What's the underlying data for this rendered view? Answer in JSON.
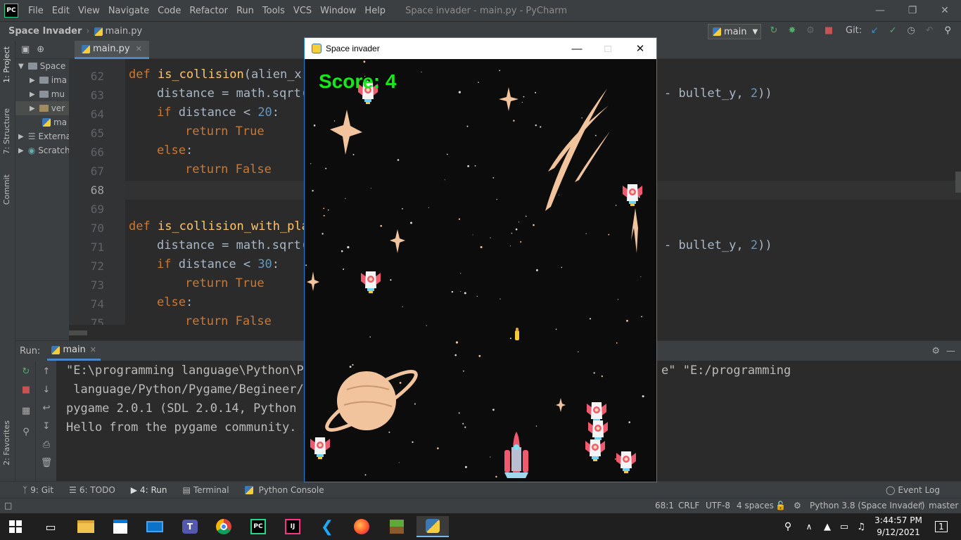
{
  "menubar": {
    "logo": "PC",
    "items": [
      "File",
      "Edit",
      "View",
      "Navigate",
      "Code",
      "Refactor",
      "Run",
      "Tools",
      "VCS",
      "Window",
      "Help"
    ],
    "title": "Space invader - main.py - PyCharm"
  },
  "navbar": {
    "project": "Space Invader",
    "file": "main.py",
    "branch": "main",
    "git_label": "Git:"
  },
  "sidebar": {
    "project_label": "1: Project",
    "structure_label": "7: Structure",
    "commit_label": "Commit",
    "favorites_label": "2: Favorites"
  },
  "project_tree": {
    "items": [
      "Space",
      "ima",
      "mu",
      "ver",
      "ma",
      "Externa",
      "Scratch"
    ]
  },
  "editor": {
    "tab": "main.py",
    "lines": [
      {
        "n": "62",
        "indent": 0,
        "parts": [
          {
            "t": "def ",
            "c": "kw"
          },
          {
            "t": "is_collision",
            "c": "fn"
          },
          {
            "t": "(alien_x,",
            "c": ""
          }
        ]
      },
      {
        "n": "63",
        "indent": 1,
        "parts": [
          {
            "t": "distance = math.sqrt(",
            "c": ""
          }
        ],
        "tail": [
          {
            "t": "- bullet_y, ",
            "c": ""
          },
          {
            "t": "2",
            "c": "num"
          },
          {
            "t": "))",
            "c": ""
          }
        ]
      },
      {
        "n": "64",
        "indent": 1,
        "parts": [
          {
            "t": "if ",
            "c": "kw"
          },
          {
            "t": "distance < ",
            "c": ""
          },
          {
            "t": "20",
            "c": "num"
          },
          {
            "t": ":",
            "c": ""
          }
        ]
      },
      {
        "n": "65",
        "indent": 2,
        "parts": [
          {
            "t": "return True",
            "c": "kw"
          }
        ]
      },
      {
        "n": "66",
        "indent": 1,
        "parts": [
          {
            "t": "else",
            "c": "kw"
          },
          {
            "t": ":",
            "c": ""
          }
        ]
      },
      {
        "n": "67",
        "indent": 2,
        "parts": [
          {
            "t": "return False",
            "c": "kw"
          }
        ]
      },
      {
        "n": "68",
        "indent": 0,
        "parts": []
      },
      {
        "n": "69",
        "indent": 0,
        "parts": []
      },
      {
        "n": "70",
        "indent": 0,
        "parts": [
          {
            "t": "def ",
            "c": "kw"
          },
          {
            "t": "is_collision_with_pla",
            "c": "fn"
          }
        ]
      },
      {
        "n": "71",
        "indent": 1,
        "parts": [
          {
            "t": "distance = math.sqrt(",
            "c": ""
          }
        ],
        "tail": [
          {
            "t": "- bullet_y, ",
            "c": ""
          },
          {
            "t": "2",
            "c": "num"
          },
          {
            "t": "))",
            "c": ""
          }
        ]
      },
      {
        "n": "72",
        "indent": 1,
        "parts": [
          {
            "t": "if ",
            "c": "kw"
          },
          {
            "t": "distance < ",
            "c": ""
          },
          {
            "t": "30",
            "c": "num"
          },
          {
            "t": ":",
            "c": ""
          }
        ]
      },
      {
        "n": "73",
        "indent": 2,
        "parts": [
          {
            "t": "return True",
            "c": "kw"
          }
        ]
      },
      {
        "n": "74",
        "indent": 1,
        "parts": [
          {
            "t": "else",
            "c": "kw"
          },
          {
            "t": ":",
            "c": ""
          }
        ]
      },
      {
        "n": "75",
        "indent": 2,
        "parts": [
          {
            "t": "return False",
            "c": "kw"
          }
        ]
      }
    ]
  },
  "run": {
    "label": "Run:",
    "tab": "main",
    "output": [
      {
        "a": "\"E:\\programming language\\Python\\Py",
        "b": "e\" \"E:/programming"
      },
      {
        "a": " language/Python/Pygame/Begineer/S",
        "b": ""
      },
      {
        "a": "pygame 2.0.1 (SDL 2.0.14, Python 3",
        "b": ""
      },
      {
        "a": "Hello from the pygame community. ",
        "link": "h",
        "b": ""
      }
    ]
  },
  "bottom_tools": {
    "git": "9: Git",
    "todo": "6: TODO",
    "run": "4: Run",
    "terminal": "Terminal",
    "console": "Python Console",
    "event_log": "Event Log"
  },
  "status": {
    "position": "68:1",
    "line_sep": "CRLF",
    "encoding": "UTF-8",
    "indent": "4 spaces",
    "interpreter": "Python 3.8 (Space Invader)",
    "branch": "master"
  },
  "game": {
    "title": "Space invader",
    "score": "Score: 4"
  },
  "taskbar": {
    "time": "3:44:57 PM",
    "date": "9/12/2021",
    "notifications": "1",
    "apps": [
      "file-explorer",
      "store",
      "mail",
      "teams",
      "chrome",
      "pycharm",
      "intellij",
      "vscode",
      "firefox",
      "minecraft",
      "python"
    ]
  }
}
